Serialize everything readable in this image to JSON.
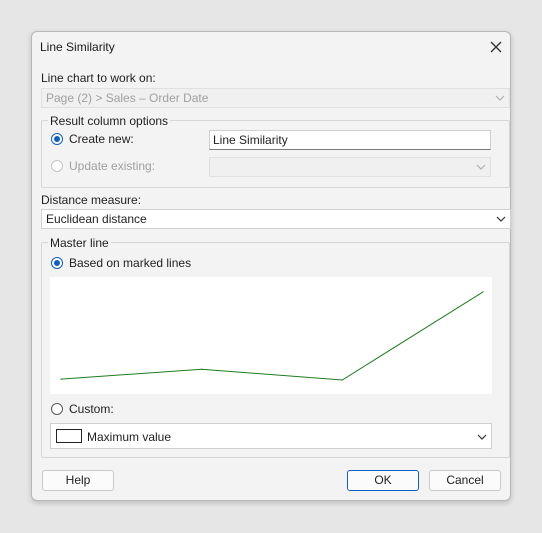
{
  "dialog": {
    "title": "Line Similarity"
  },
  "line_chart": {
    "label": "Line chart to work on:",
    "value": "Page (2) > Sales – Order Date"
  },
  "result_options": {
    "group_title": "Result column options",
    "create_new_label": "Create new:",
    "create_new_value": "Line Similarity",
    "update_existing_label": "Update existing:",
    "update_existing_value": ""
  },
  "distance": {
    "label": "Distance measure:",
    "value": "Euclidean distance"
  },
  "master_line": {
    "group_title": "Master line",
    "based_on_label": "Based on marked lines",
    "custom_label": "Custom:",
    "custom_value": "Maximum value"
  },
  "chart_data": {
    "type": "line",
    "x": [
      1,
      2,
      3,
      4
    ],
    "series": [
      {
        "values": [
          10,
          21,
          9,
          108
        ],
        "color": "#1e7d1e"
      }
    ],
    "ylim": [
      0,
      118
    ],
    "grid": false
  },
  "buttons": {
    "help": "Help",
    "ok": "OK",
    "cancel": "Cancel"
  },
  "colors": {
    "accent": "#0f5fc8",
    "line": "#1e7d1e"
  },
  "icons": {
    "close": "close-icon",
    "dropdown": "chevron-down-icon"
  }
}
